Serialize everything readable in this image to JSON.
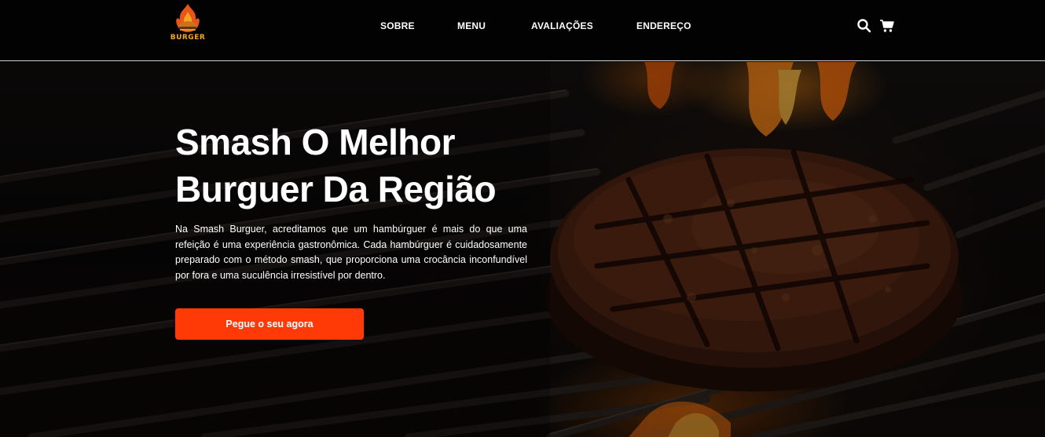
{
  "brand": {
    "logo_text": "BURGER",
    "accent": "#ff3a06"
  },
  "nav": {
    "links": [
      "SOBRE",
      "MENU",
      "AVALIAÇÕES",
      "ENDEREÇO"
    ],
    "icons": [
      "search-icon",
      "cart-icon"
    ]
  },
  "hero": {
    "title": "Smash O Melhor\nBurguer Da Região",
    "description": "Na Smash Burguer, acreditamos que um hambúrguer é mais do que uma refeição é uma experiência gastronômica. Cada hambúrguer é cuidadosamente preparado com o método smash, que proporciona uma crocância inconfundível por fora e uma suculência irresistível por dentro.",
    "cta_label": "Pegue o seu agora"
  }
}
